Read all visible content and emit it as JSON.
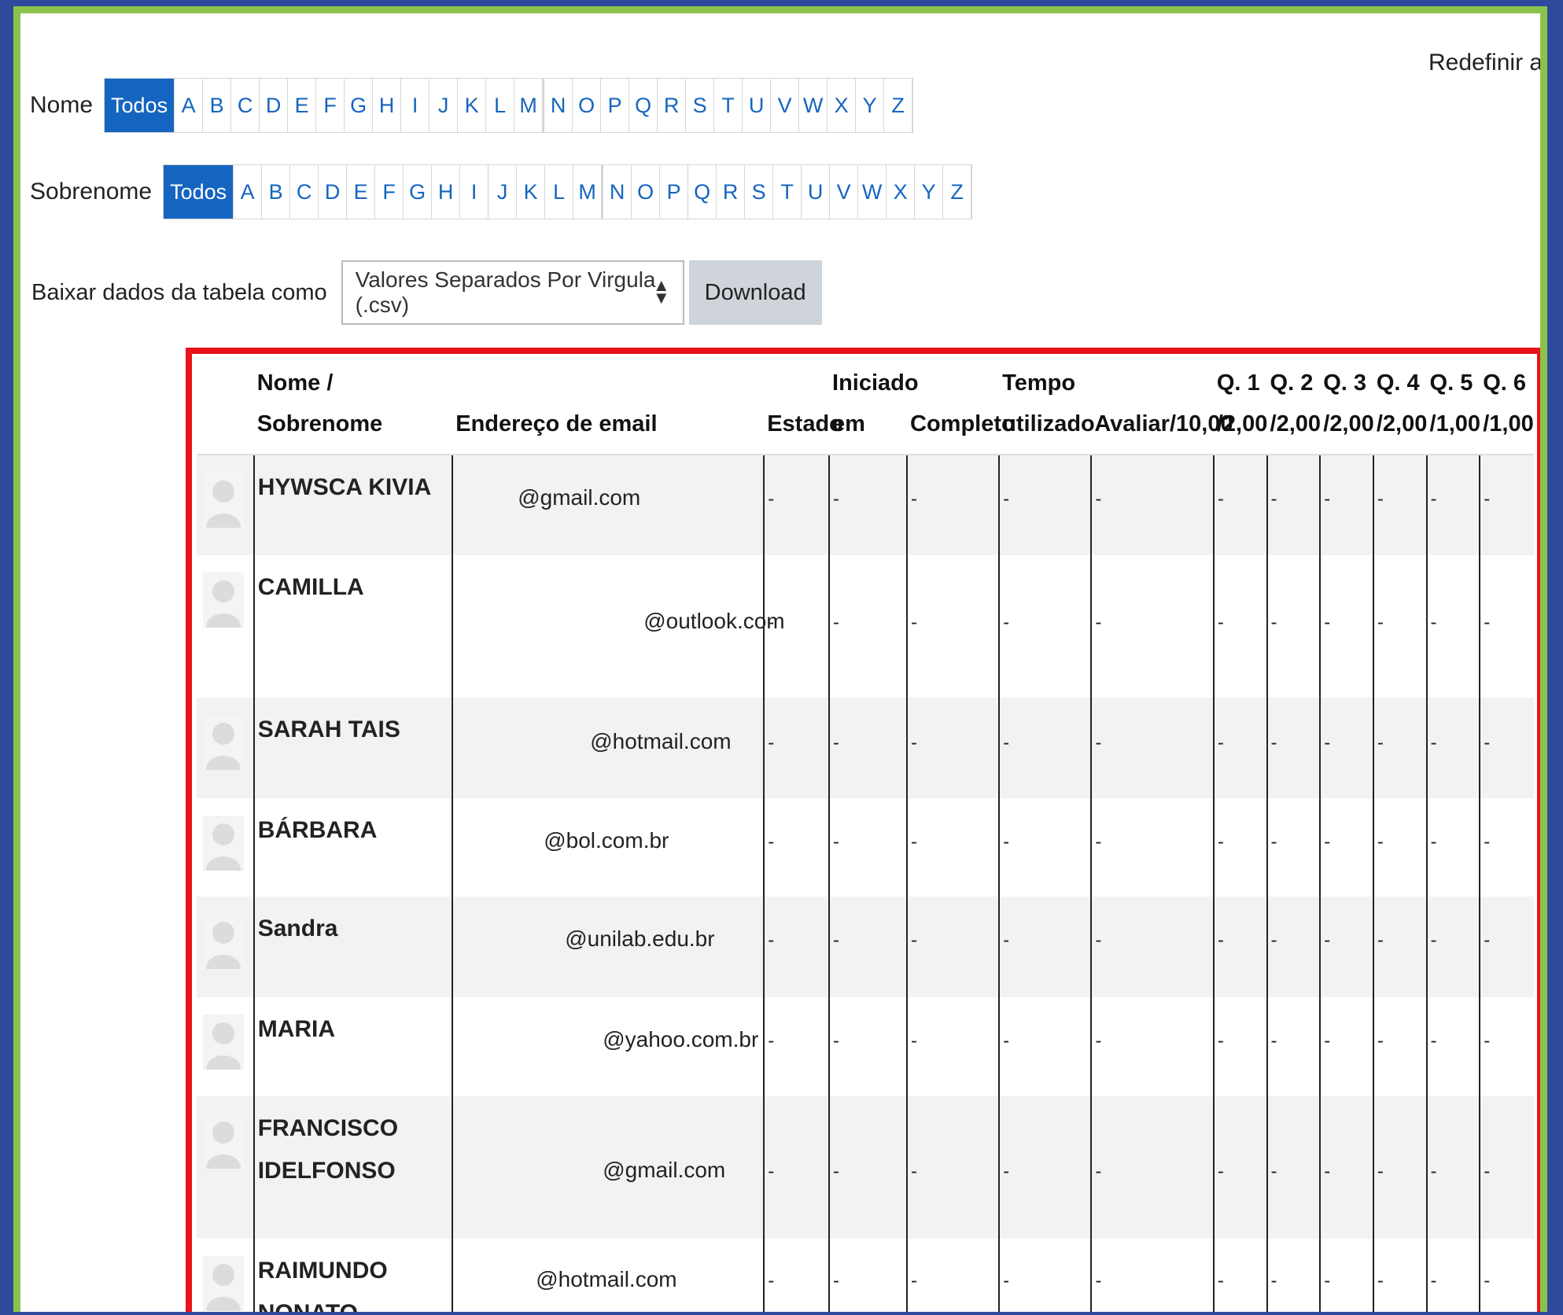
{
  "reset_link": "Redefinir as prefe",
  "filters": {
    "first_name": {
      "label": "Nome",
      "all": "Todos"
    },
    "last_name": {
      "label": "Sobrenome",
      "all": "Todos"
    },
    "letters_a": [
      "A",
      "B",
      "C",
      "D",
      "E",
      "F",
      "G",
      "H",
      "I",
      "J",
      "K",
      "L",
      "M"
    ],
    "letters_b": [
      "N",
      "O",
      "P",
      "Q",
      "R",
      "S",
      "T",
      "U",
      "V",
      "W",
      "X",
      "Y",
      "Z"
    ]
  },
  "download": {
    "label": "Baixar dados da tabela como",
    "selected_format": "Valores Separados Por Virgula (.csv)",
    "button": "Download"
  },
  "table": {
    "headers": {
      "name": "Nome / Sobrenome",
      "email": "Endereço de email",
      "state": "Estado",
      "started_1": "Iniciado",
      "started_2": "em",
      "completed": "Completo",
      "time_1": "Tempo",
      "time_2": "utilizado",
      "grade": "Avaliar/10,00",
      "q1_1": "Q. 1",
      "q1_2": "/2,00",
      "q2_1": "Q. 2",
      "q2_2": "/2,00",
      "q3_1": "Q. 3",
      "q3_2": "/2,00",
      "q4_1": "Q. 4",
      "q4_2": "/2,00",
      "q5_1": "Q. 5",
      "q5_2": "/1,00",
      "q6_1": "Q. 6",
      "q6_2": "/1,00"
    },
    "rows": [
      {
        "name": "HYWSCA KIVIA",
        "email": "@gmail.com"
      },
      {
        "name": "CAMILLA",
        "email": "@outlook.com"
      },
      {
        "name": "SARAH TAIS",
        "email": "@hotmail.com"
      },
      {
        "name": "BÁRBARA",
        "email": "@bol.com.br"
      },
      {
        "name": "Sandra",
        "email": "@unilab.edu.br"
      },
      {
        "name": "MARIA",
        "email": "@yahoo.com.br"
      },
      {
        "name": "FRANCISCO IDELFONSO",
        "email": "@gmail.com"
      },
      {
        "name": "RAIMUNDO NONATO",
        "email": "@hotmail.com"
      }
    ],
    "empty_value": "-"
  }
}
